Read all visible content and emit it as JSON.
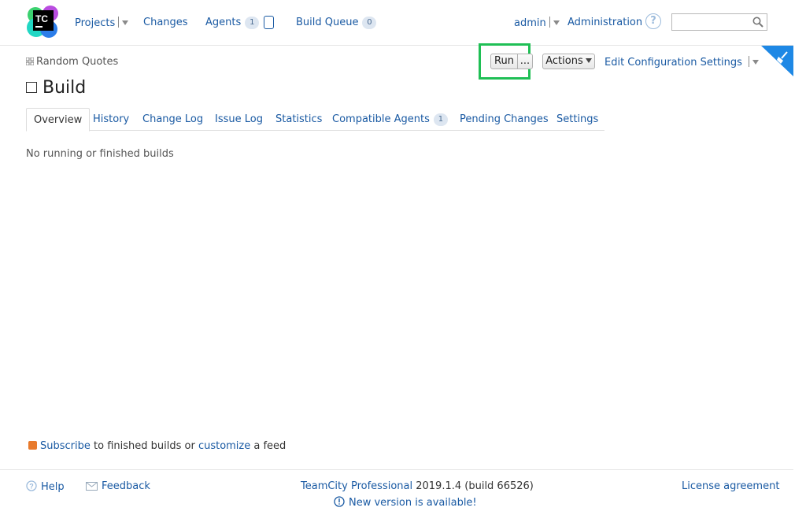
{
  "header": {
    "logo_text": "TC",
    "nav": {
      "projects": "Projects",
      "changes": "Changes",
      "agents": "Agents",
      "agents_count": "1",
      "build_queue": "Build Queue",
      "build_queue_count": "0"
    },
    "user": "admin",
    "administration": "Administration",
    "help_glyph": "?",
    "search_placeholder": ""
  },
  "breadcrumb": {
    "project": "Random Quotes"
  },
  "page": {
    "title": "Build"
  },
  "toolbar": {
    "run_label": "Run",
    "more_label": "...",
    "actions_label": "Actions",
    "edit_settings_label": "Edit Configuration Settings"
  },
  "tabs": [
    {
      "label": "Overview",
      "active": true
    },
    {
      "label": "History"
    },
    {
      "label": "Change Log"
    },
    {
      "label": "Issue Log"
    },
    {
      "label": "Statistics"
    },
    {
      "label": "Compatible Agents",
      "badge": "1"
    },
    {
      "label": "Pending Changes"
    },
    {
      "label": "Settings"
    }
  ],
  "main": {
    "empty_message": "No running or finished builds"
  },
  "feed": {
    "subscribe": "Subscribe",
    "text1": " to finished builds or ",
    "customize": "customize",
    "text2": " a feed"
  },
  "footer": {
    "help": "Help",
    "feedback": "Feedback",
    "product": "TeamCity Professional",
    "version": " 2019.1.4 (build 66526)",
    "new_version": "New version is available!",
    "license": "License agreement"
  },
  "colors": {
    "link": "#1a5aa3",
    "highlight": "#1fbf55",
    "corner": "#1e88e5"
  }
}
